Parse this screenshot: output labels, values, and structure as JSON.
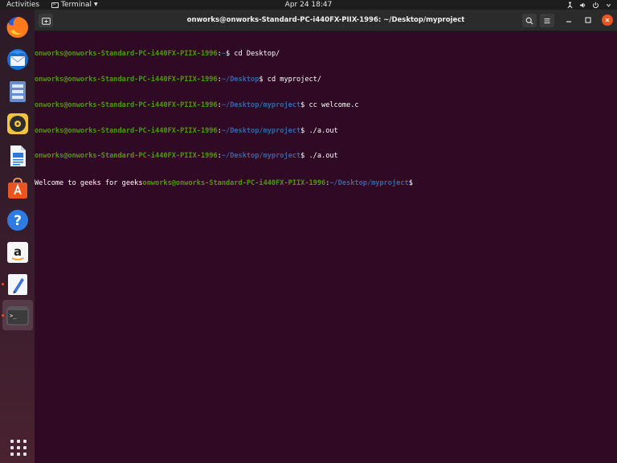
{
  "topbar": {
    "activities": "Activities",
    "app_menu": "Terminal",
    "clock": "Apr 24  18:47",
    "tray_icons": [
      "network-icon",
      "volume-icon",
      "power-icon",
      "chevron-down-icon"
    ]
  },
  "dock": {
    "apps": [
      "firefox",
      "thunderbird",
      "files",
      "rhythmbox",
      "libreoffice-writer",
      "ubuntu-software",
      "help",
      "amazon",
      "text-editor",
      "terminal"
    ]
  },
  "window": {
    "title": "onworks@onworks-Standard-PC-i440FX-PIIX-1996: ~/Desktop/myproject"
  },
  "terminal": {
    "lines": [
      {
        "user": "onworks@onworks-Standard-PC-i440FX-PIIX-1996",
        "sep": ":",
        "path": "~",
        "cmd": "$ cd Desktop/"
      },
      {
        "user": "onworks@onworks-Standard-PC-i440FX-PIIX-1996",
        "sep": ":",
        "path": "~/Desktop",
        "cmd": "$ cd myproject/"
      },
      {
        "user": "onworks@onworks-Standard-PC-i440FX-PIIX-1996",
        "sep": ":",
        "path": "~/Desktop/myproject",
        "cmd": "$ cc welcome.c"
      },
      {
        "user": "onworks@onworks-Standard-PC-i440FX-PIIX-1996",
        "sep": ":",
        "path": "~/Desktop/myproject",
        "cmd": "$ ./a.out"
      },
      {
        "user": "onworks@onworks-Standard-PC-i440FX-PIIX-1996",
        "sep": ":",
        "path": "~/Desktop/myproject",
        "cmd": "$ ./a.out"
      }
    ],
    "output": "Welcome to geeks for geeks",
    "final_prompt": {
      "user": "onworks@onworks-Standard-PC-i440FX-PIIX-1996",
      "sep": ":",
      "path": "~/Desktop/myproject",
      "cmd": "$ "
    }
  },
  "colors": {
    "terminal_bg": "#300a24",
    "prompt_user": "#4e9a06",
    "prompt_path": "#3465a4",
    "accent": "#e95420"
  }
}
